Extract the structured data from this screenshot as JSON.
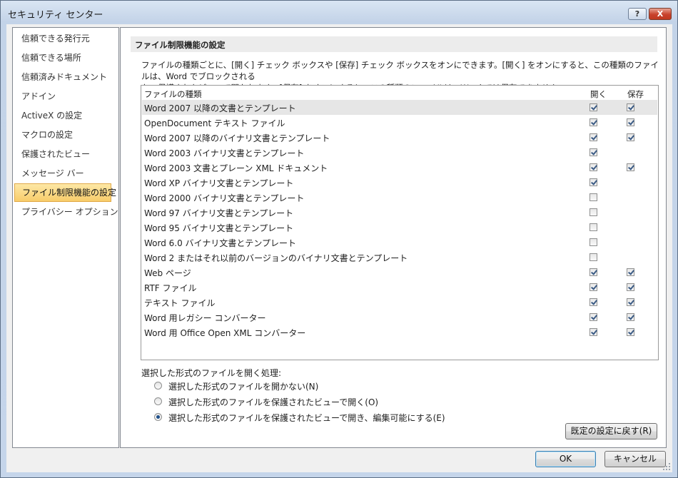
{
  "window": {
    "title": "セキュリティ センター",
    "help_label": "?",
    "close_label": "X"
  },
  "nav": {
    "items": [
      {
        "label": "信頼できる発行元"
      },
      {
        "label": "信頼できる場所"
      },
      {
        "label": "信頼済みドキュメント"
      },
      {
        "label": "アドイン"
      },
      {
        "label": "ActiveX の設定"
      },
      {
        "label": "マクロの設定"
      },
      {
        "label": "保護されたビュー"
      },
      {
        "label": "メッセージ バー"
      },
      {
        "label": "ファイル制限機能の設定",
        "selected": true
      },
      {
        "label": "プライバシー オプション"
      }
    ]
  },
  "section": {
    "title": "ファイル制限機能の設定",
    "description_line1": "ファイルの種類ごとに、[開く] チェック ボックスや [保存] チェック ボックスをオンにできます。[開く] をオンにすると、この種類のファイルは、Word でブロックされる",
    "description_line2": "か、保護されたビューで開かれます。[保存] をオンにすると、この種類のファイルは、Word では保存できません。"
  },
  "grid": {
    "col_type": "ファイルの種類",
    "col_open": "開く",
    "col_save": "保存",
    "rows": [
      {
        "label": "Word 2007 以降の文書とテンプレート",
        "open": true,
        "save": true,
        "selected": true
      },
      {
        "label": "OpenDocument テキスト ファイル",
        "open": true,
        "save": true
      },
      {
        "label": "Word 2007 以降のバイナリ文書とテンプレート",
        "open": true,
        "save": true
      },
      {
        "label": "Word 2003 バイナリ文書とテンプレート",
        "open": true,
        "save": null
      },
      {
        "label": "Word 2003 文書とプレーン XML ドキュメント",
        "open": true,
        "save": true
      },
      {
        "label": "Word XP バイナリ文書とテンプレート",
        "open": true,
        "save": null
      },
      {
        "label": "Word 2000 バイナリ文書とテンプレート",
        "open": false,
        "save": null
      },
      {
        "label": "Word 97 バイナリ文書とテンプレート",
        "open": false,
        "save": null
      },
      {
        "label": "Word 95 バイナリ文書とテンプレート",
        "open": false,
        "save": null
      },
      {
        "label": "Word 6.0 バイナリ文書とテンプレート",
        "open": false,
        "save": null
      },
      {
        "label": "Word 2 またはそれ以前のバージョンのバイナリ文書とテンプレート",
        "open": false,
        "save": null
      },
      {
        "label": "Web ページ",
        "open": true,
        "save": true
      },
      {
        "label": "RTF ファイル",
        "open": true,
        "save": true
      },
      {
        "label": "テキスト ファイル",
        "open": true,
        "save": true
      },
      {
        "label": "Word 用レガシー コンバーター",
        "open": true,
        "save": true
      },
      {
        "label": "Word 用 Office Open XML コンバーター",
        "open": true,
        "save": true
      }
    ]
  },
  "open_behavior": {
    "label": "選択した形式のファイルを開く処理:",
    "options": [
      {
        "label": "選択した形式のファイルを開かない(N)",
        "checked": false
      },
      {
        "label": "選択した形式のファイルを保護されたビューで開く(O)",
        "checked": false
      },
      {
        "label": "選択した形式のファイルを保護されたビューで開き、編集可能にする(E)",
        "checked": true
      }
    ]
  },
  "buttons": {
    "restore_defaults": "既定の設定に戻す(R)",
    "ok": "OK",
    "cancel": "キャンセル"
  }
}
